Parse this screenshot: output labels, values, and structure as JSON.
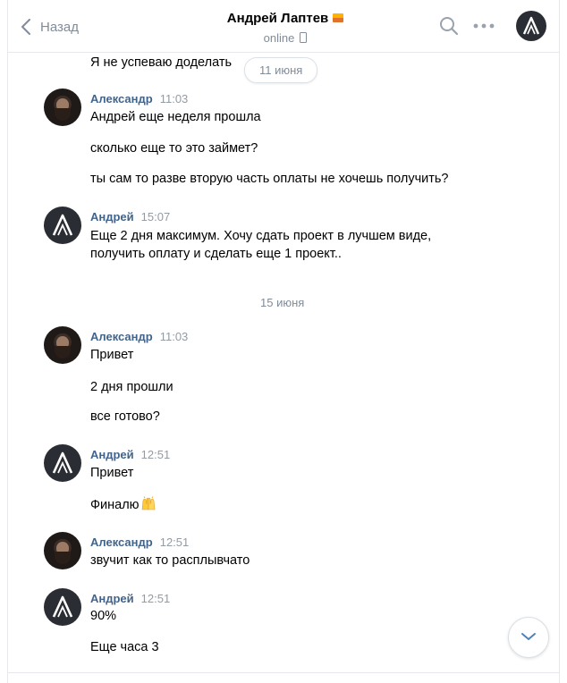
{
  "header": {
    "back_label": "Назад",
    "contact_name": "Андрей Лаптев",
    "status": "online"
  },
  "messages": {
    "partial_top": "Я не успеваю доделать",
    "date1": "11 июня",
    "g1": {
      "name": "Александр",
      "time": "11:03",
      "lines": [
        "Андрей еще неделя прошла",
        "сколько еще то это займет?",
        "ты сам то разве вторую часть оплаты не хочешь получить?"
      ]
    },
    "g2": {
      "name": "Андрей",
      "time": "15:07",
      "lines": [
        "Еще 2 дня максимум. Хочу сдать проект в лучшем виде,",
        "получить оплату и сделать еще 1 проект.."
      ]
    },
    "date2": "15 июня",
    "g3": {
      "name": "Александр",
      "time": "11:03",
      "lines": [
        "Привет",
        "2 дня прошли",
        "все готово?"
      ]
    },
    "g4": {
      "name": "Андрей",
      "time": "12:51",
      "lines": [
        "Привет",
        "Финалю"
      ]
    },
    "g5": {
      "name": "Александр",
      "time": "12:51",
      "lines": [
        "звучит как то расплывчато"
      ]
    },
    "g6": {
      "name": "Андрей",
      "time": "12:51",
      "lines": [
        "90%",
        "Еще часа 3"
      ]
    }
  },
  "icons": {
    "back": "chevron-left-icon",
    "search": "search-icon",
    "more": "more-horizontal-icon",
    "scroll": "chevron-down-icon",
    "emoji": "raised-hands-emoji"
  },
  "colors": {
    "name": "#42648b",
    "secondary": "#818c99",
    "time": "#939ba3",
    "divider": "#e7e8ec"
  }
}
